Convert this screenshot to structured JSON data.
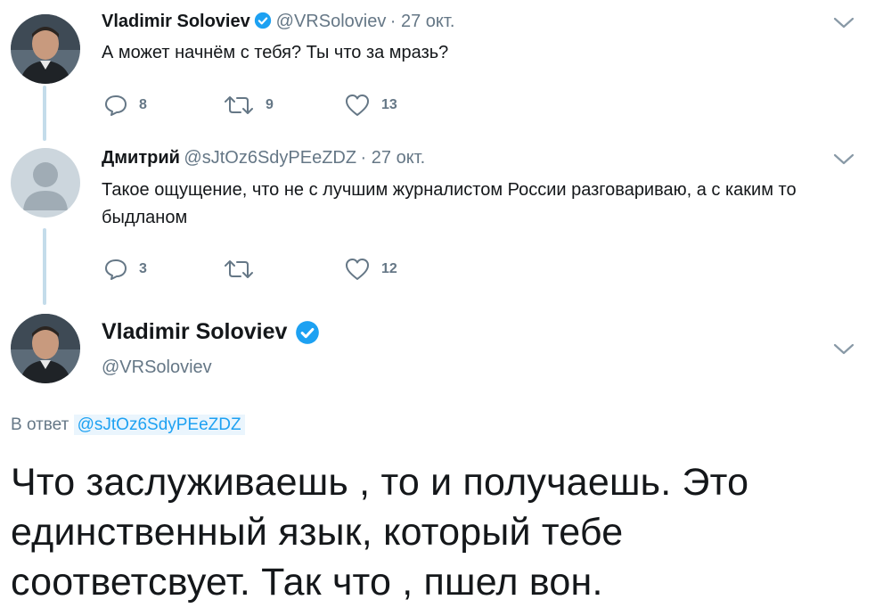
{
  "tweet1": {
    "name": "Vladimir Soloviev",
    "handle": "@VRSoloviev",
    "time": "· 27 окт.",
    "text": "А может начнём с тебя? Ты что за мразь?",
    "replies": "8",
    "retweets": "9",
    "likes": "13"
  },
  "tweet2": {
    "name": "Дмитрий",
    "handle": "@sJtOz6SdyPEeZDZ",
    "time": "· 27 окт.",
    "text": "Такое ощущение, что не с лучшим журналистом России разговариваю, а с каким то быдланом",
    "replies": "3",
    "retweets": "",
    "likes": "12"
  },
  "main_tweet": {
    "name": "Vladimir Soloviev",
    "handle": "@VRSoloviev",
    "reply_prefix": "В ответ",
    "reply_handle": "@sJtOz6SdyPEeZDZ",
    "text": "Что заслуживаешь , то и получаешь. Это единственный язык, который тебе соответсвует. Так что , пшел вон."
  },
  "colors": {
    "accent": "#1da1f2",
    "thread_line": "#c4dcea",
    "secondary_text": "#657786"
  },
  "icons": {
    "reply": "reply-icon",
    "retweet": "retweet-icon",
    "like": "heart-icon",
    "more": "chevron-down-icon",
    "verified": "verified-badge-icon"
  }
}
